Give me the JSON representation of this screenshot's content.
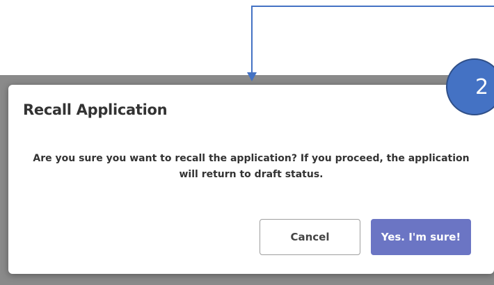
{
  "dialog": {
    "title": "Recall Application",
    "message": "Are you sure you want to recall the application? If you proceed, the application will return to draft status.",
    "cancel_label": "Cancel",
    "confirm_label": "Yes. I'm sure!"
  },
  "annotation": {
    "step_number": "2",
    "badge_color": "#4472c4",
    "arrow_color": "#4472c4"
  },
  "colors": {
    "confirm_button": "#6b75c4",
    "backdrop": "#8a8a8a"
  }
}
